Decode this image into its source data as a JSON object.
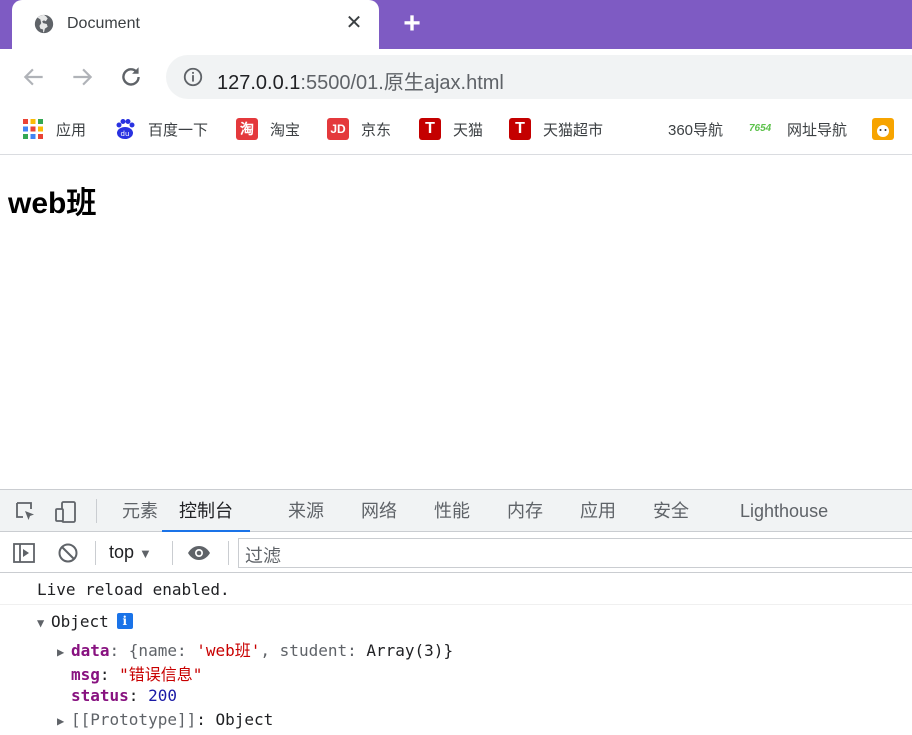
{
  "browser": {
    "tab": {
      "title": "Document",
      "close_label": "✕"
    },
    "new_tab_label": "+",
    "url": {
      "host": "127.0.0.1",
      "path": ":5500/01.原生ajax.html"
    }
  },
  "bookmarks": [
    {
      "label": "应用",
      "icon": "apps-grid-icon"
    },
    {
      "label": "百度一下",
      "icon": "baidu-icon"
    },
    {
      "label": "淘宝",
      "icon": "taobao-icon",
      "glyph": "淘",
      "color": "#e4393c"
    },
    {
      "label": "京东",
      "icon": "jd-icon",
      "glyph": "JD",
      "color": "#e4393c"
    },
    {
      "label": "天猫",
      "icon": "tmall-icon",
      "glyph": "T",
      "color": "#c40000"
    },
    {
      "label": "天猫超市",
      "icon": "tmall-market-icon",
      "glyph": "T",
      "color": "#c40000"
    },
    {
      "label": "360导航",
      "icon": ""
    },
    {
      "label": "网址导航",
      "icon": "7654-icon",
      "glyph": "7654",
      "color": "#5dc24c"
    }
  ],
  "page": {
    "heading": "web班"
  },
  "devtools": {
    "tabs": [
      "元素",
      "控制台",
      "来源",
      "网络",
      "性能",
      "内存",
      "应用",
      "安全",
      "Lighthouse"
    ],
    "active_tab": "控制台",
    "context": "top",
    "filter_placeholder": "过滤",
    "console": {
      "reload_msg": "Live reload enabled.",
      "object_label": "Object",
      "info_badge": "i",
      "data_key": "data",
      "data_open": ": {name: ",
      "data_name_value": "'web班'",
      "data_mid": ", student: ",
      "data_student_value": "Array(3)",
      "data_close": "}",
      "msg_key": "msg",
      "msg_value": "\"错误信息\"",
      "status_key": "status",
      "status_value": "200",
      "proto_key": "[[Prototype]]",
      "proto_value": "Object"
    }
  }
}
